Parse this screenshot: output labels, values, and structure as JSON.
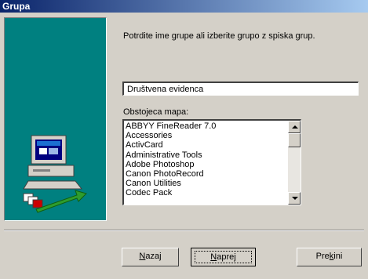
{
  "window": {
    "title": "Grupa"
  },
  "instruction": "Potrdite ime grupe ali izberite grupo z spiska grup.",
  "group_name": {
    "value": "Društvena evidenca"
  },
  "folder_label": "Obstojeca mapa:",
  "folders": [
    "ABBYY FineReader 7.0",
    "Accessories",
    "ActivCard",
    "Administrative Tools",
    "Adobe Photoshop",
    "Canon PhotoRecord",
    "Canon Utilities",
    "Codec Pack"
  ],
  "buttons": {
    "back_ul": "N",
    "back_rest": "azaj",
    "next_ul": "N",
    "next_rest": "aprej",
    "cancel_pre": "Pre",
    "cancel_ul": "k",
    "cancel_rest": "ini"
  }
}
